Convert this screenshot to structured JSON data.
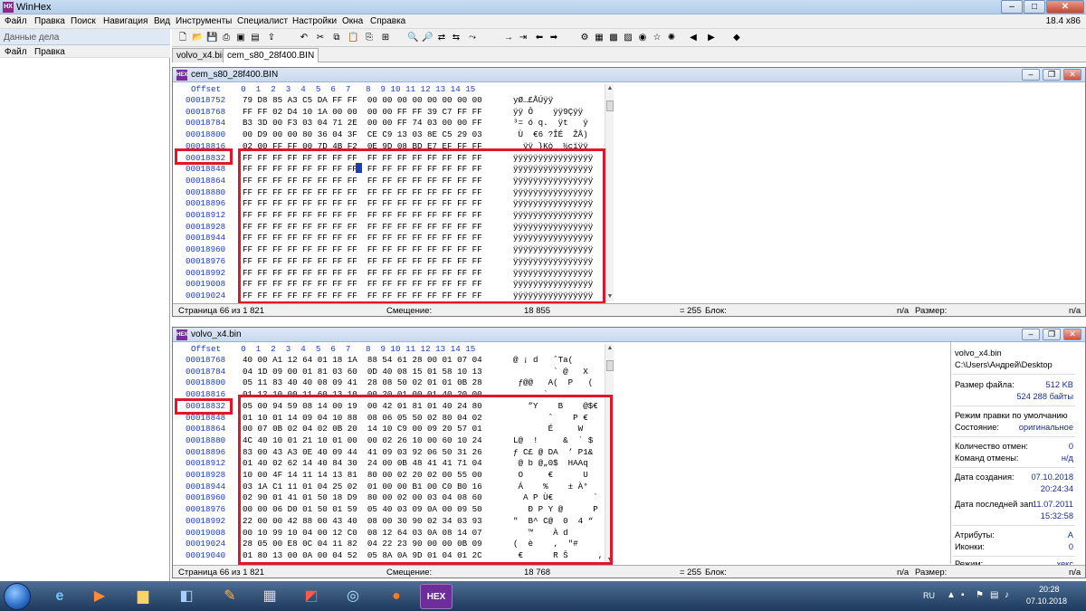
{
  "app": {
    "title": "WinHex",
    "version": "18.4 x86"
  },
  "menu": [
    "Файл",
    "Правка",
    "Поиск",
    "Навигация",
    "Вид",
    "Инструменты",
    "Специалист",
    "Настройки",
    "Окна",
    "Справка"
  ],
  "left_panel": {
    "title": "Данные дела",
    "menu": [
      "Файл",
      "Правка"
    ]
  },
  "tabs": [
    "volvo_x4.bin",
    "cem_s80_28f400.BIN"
  ],
  "hex_header": "Offset    0  1  2  3  4  5  6  7   8  9 10 11 12 13 14 15",
  "pane1": {
    "title": "cem_s80_28f400.BIN",
    "offsets": "00018752\n00018768\n00018784\n00018800\n00018816\n00018832\n00018848\n00018864\n00018880\n00018896\n00018912\n00018928\n00018944\n00018960\n00018976\n00018992\n00019008\n00019024",
    "hex": "79 D8 85 A3 C5 DA FF FF  00 00 00 00 00 00 00 00\nFF FF 02 D4 10 1A 00 00  00 00 FF FF 39 C7 FF FF\nB3 3D 00 F3 03 04 71 2E  00 00 FF 74 03 00 00 FF\n00 D9 00 00 80 36 04 3F  CE C9 13 03 8E C5 29 03\n02 00 FF FF 00 7D 4B F2  0E 9D 08 BD E7 EF FF FF\nFF FF FF FF FF FF FF FF  FF FF FF FF FF FF FF FF\nFF FF FF FF FF FF FF FF  FF FF FF FF FF FF FF FF\nFF FF FF FF FF FF FF FF  FF FF FF FF FF FF FF FF\nFF FF FF FF FF FF FF FF  FF FF FF FF FF FF FF FF\nFF FF FF FF FF FF FF FF  FF FF FF FF FF FF FF FF\nFF FF FF FF FF FF FF FF  FF FF FF FF FF FF FF FF\nFF FF FF FF FF FF FF FF  FF FF FF FF FF FF FF FF\nFF FF FF FF FF FF FF FF  FF FF FF FF FF FF FF FF\nFF FF FF FF FF FF FF FF  FF FF FF FF FF FF FF FF\nFF FF FF FF FF FF FF FF  FF FF FF FF FF FF FF FF\nFF FF FF FF FF FF FF FF  FF FF FF FF FF FF FF FF\nFF FF FF FF FF FF FF FF  FF FF FF FF FF FF FF FF\nFF FF FF FF FF FF FF FF  FF FF FF FF FF FF FF FF",
    "ascii": "yØ…£ÅÚÿÿ\nÿÿ Ô    ÿÿ9Çÿÿ\n³= ó q.  ÿt   ÿ\n Ù  €6 ?ÎÉ  ŽÅ)\n  ÿÿ }Kò  ½çïÿÿ\nÿÿÿÿÿÿÿÿÿÿÿÿÿÿÿÿ\nÿÿÿÿÿÿÿÿÿÿÿÿÿÿÿÿ\nÿÿÿÿÿÿÿÿÿÿÿÿÿÿÿÿ\nÿÿÿÿÿÿÿÿÿÿÿÿÿÿÿÿ\nÿÿÿÿÿÿÿÿÿÿÿÿÿÿÿÿ\nÿÿÿÿÿÿÿÿÿÿÿÿÿÿÿÿ\nÿÿÿÿÿÿÿÿÿÿÿÿÿÿÿÿ\nÿÿÿÿÿÿÿÿÿÿÿÿÿÿÿÿ\nÿÿÿÿÿÿÿÿÿÿÿÿÿÿÿÿ\nÿÿÿÿÿÿÿÿÿÿÿÿÿÿÿÿ\nÿÿÿÿÿÿÿÿÿÿÿÿÿÿÿÿ\nÿÿÿÿÿÿÿÿÿÿÿÿÿÿÿÿ\nÿÿÿÿÿÿÿÿÿÿÿÿÿÿÿÿ",
    "status": {
      "page": "Страница 66 из 1 821",
      "offset_label": "Смещение:",
      "offset_value": "18 855",
      "eq": "= 255",
      "block_label": "Блок:",
      "block_value": "n/a",
      "size_label": "Размер:",
      "size_value": "n/a"
    }
  },
  "pane2": {
    "title": "volvo_x4.bin",
    "offsets": "00018768\n00018784\n00018800\n00018816\n00018832\n00018848\n00018864\n00018880\n00018896\n00018912\n00018928\n00018944\n00018960\n00018976\n00018992\n00019008\n00019024\n00019040",
    "hex": "40 00 A1 12 64 01 18 1A  88 54 61 28 00 01 07 04\n04 1D 09 00 01 81 03 60  0D 40 08 15 01 58 10 13\n05 11 83 40 40 08 09 41  28 08 50 02 01 01 0B 28\n01 12 10 00 11 60 13 10  00 20 01 00 01 40 20 00\n05 00 94 59 08 14 00 19  00 42 01 81 01 40 24 80\n01 10 01 14 09 04 10 88  08 06 05 50 02 80 04 02\n00 07 0B 02 04 02 0B 20  14 10 C9 00 09 20 57 01\n4C 40 10 01 21 10 01 00  00 02 26 10 00 60 10 24\n83 00 43 A3 0E 40 09 44  41 09 03 92 06 50 31 26\n01 40 02 62 14 40 84 30  24 00 0B 48 41 41 71 04\n10 00 4F 14 11 14 13 81  80 00 02 20 02 00 55 00\n03 1A C1 11 01 04 25 02  01 00 00 B1 00 C0 B0 16\n02 90 01 41 01 50 18 D9  80 00 02 00 03 04 08 60\n00 00 06 D0 01 50 01 59  05 40 03 09 0A 00 09 50\n22 00 00 42 88 00 43 40  08 00 30 90 02 34 03 93\n00 10 99 10 04 00 12 C0  08 12 64 03 0A 08 14 07\n28 05 00 E8 0C 04 11 82  04 22 23 90 00 00 0B 09\n01 80 13 00 0A 00 04 52  05 8A 0A 9D 01 04 01 2C",
    "ascii": "@ ¡ d   ˆTa(\n        ` @   X\n ƒ@@   A(  P   (\n      ` \n   ”Y    B    @$€\n       ˆ    P €\n       É     W\nL@  !     &  ` $\nƒ C£ @ DA  ’ P1&\n @ b @„0$  HAAq\n O     €      U\n Á    %    ± À°\n  A P Ù€        `\n   Ð P Y @      P\n\"  B^ C@  0  4 “\n   ™    À d\n(  è    ‚  \"#\n €      R Š      ,",
    "status": {
      "page": "Страница 66 из 1 821",
      "offset_label": "Смещение:",
      "offset_value": "18 768",
      "eq": "= 255",
      "block_label": "Блок:",
      "block_value": "n/a",
      "size_label": "Размер:",
      "size_value": "n/a"
    }
  },
  "highlighted_offset": "00018832",
  "file_info": {
    "name": "volvo_x4.bin",
    "path": "C:\\Users\\Андрей\\Desktop",
    "size_label": "Размер файла:",
    "size_kb": "512 KB",
    "size_bytes": "524 288 байты",
    "edit_mode_label": "Режим правки по умолчанию",
    "state_label": "Состояние:",
    "state_value": "оригинальное",
    "undo_count_label": "Количество отмен:",
    "undo_count_value": "0",
    "undo_cmd_label": "Команд отмены:",
    "undo_cmd_value": "н/д",
    "created_label": "Дата создания:",
    "created_date": "07.10.2018",
    "created_time": "20:24:34",
    "modified_label": "Дата последней записи:",
    "modified_date": "11.07.2011",
    "modified_time": "15:32:58",
    "attr_label": "Атрибуты:",
    "attr_value": "A",
    "icons_label": "Иконки:",
    "icons_value": "0",
    "mode_label": "Режим:",
    "mode_value": "хекс"
  },
  "taskbar": {
    "lang": "RU",
    "time": "20:28",
    "date": "07.10.2018",
    "hex_label": "HEX"
  },
  "colors": {
    "accent_red": "#e0162b",
    "offset_blue": "#1a3cc2"
  }
}
